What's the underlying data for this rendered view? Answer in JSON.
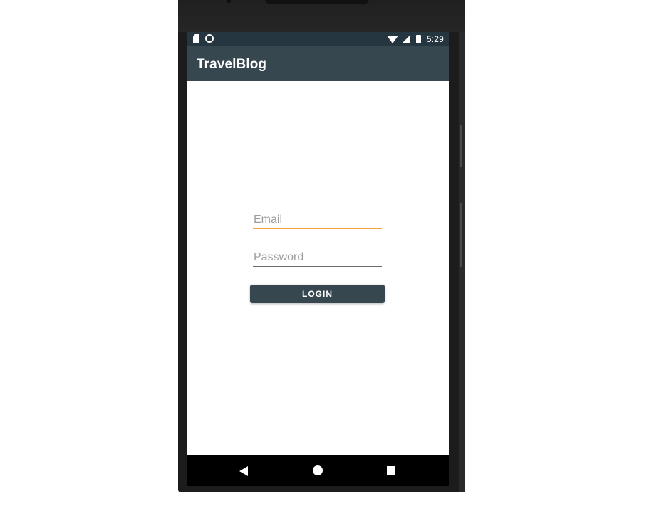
{
  "status_bar": {
    "time": "5:29",
    "icons": [
      "sd-card-icon",
      "sync-icon",
      "wifi-icon",
      "signal-icon",
      "battery-icon"
    ]
  },
  "app_bar": {
    "title": "TravelBlog"
  },
  "login_form": {
    "email_placeholder": "Email",
    "password_placeholder": "Password",
    "login_label": "LOGIN"
  },
  "nav_bar": {
    "icons": [
      "back-icon",
      "home-icon",
      "recents-icon"
    ]
  },
  "colors": {
    "primary": "#37474f",
    "status_bar": "#263640",
    "accent": "#f7a43c"
  }
}
